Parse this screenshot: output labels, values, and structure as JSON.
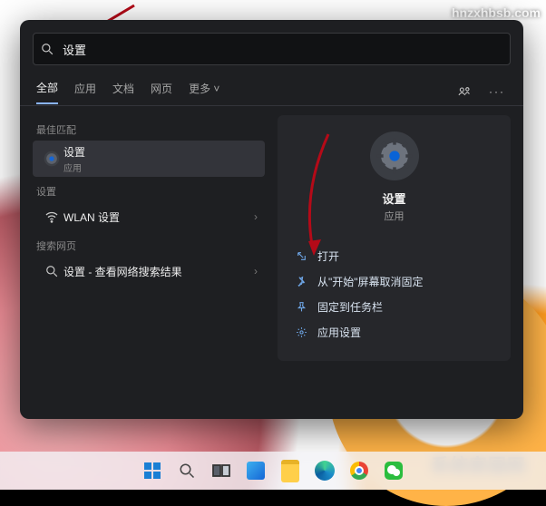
{
  "watermark": {
    "top": "hnzxhbsb.com",
    "bottom": "系统家园网"
  },
  "search": {
    "value": "设置",
    "placeholder": ""
  },
  "tabs": {
    "items": [
      "全部",
      "应用",
      "文档",
      "网页"
    ],
    "more": "更多",
    "active_index": 0
  },
  "left": {
    "best_match_label": "最佳匹配",
    "best_match": {
      "title": "设置",
      "sub": "应用",
      "icon": "gear"
    },
    "settings_label": "设置",
    "settings_item": {
      "title": "WLAN 设置",
      "icon": "wifi"
    },
    "web_label": "搜索网页",
    "web_item": {
      "title": "设置 - 查看网络搜索结果",
      "icon": "search"
    }
  },
  "detail": {
    "title": "设置",
    "sub": "应用",
    "actions": [
      {
        "icon": "open",
        "label": "打开"
      },
      {
        "icon": "unpin",
        "label": "从\"开始\"屏幕取消固定"
      },
      {
        "icon": "pin",
        "label": "固定到任务栏"
      },
      {
        "icon": "gear",
        "label": "应用设置"
      }
    ]
  },
  "taskbar": {
    "items": [
      "start",
      "search",
      "taskview",
      "widgets",
      "explorer",
      "edge",
      "chrome",
      "wechat"
    ]
  }
}
